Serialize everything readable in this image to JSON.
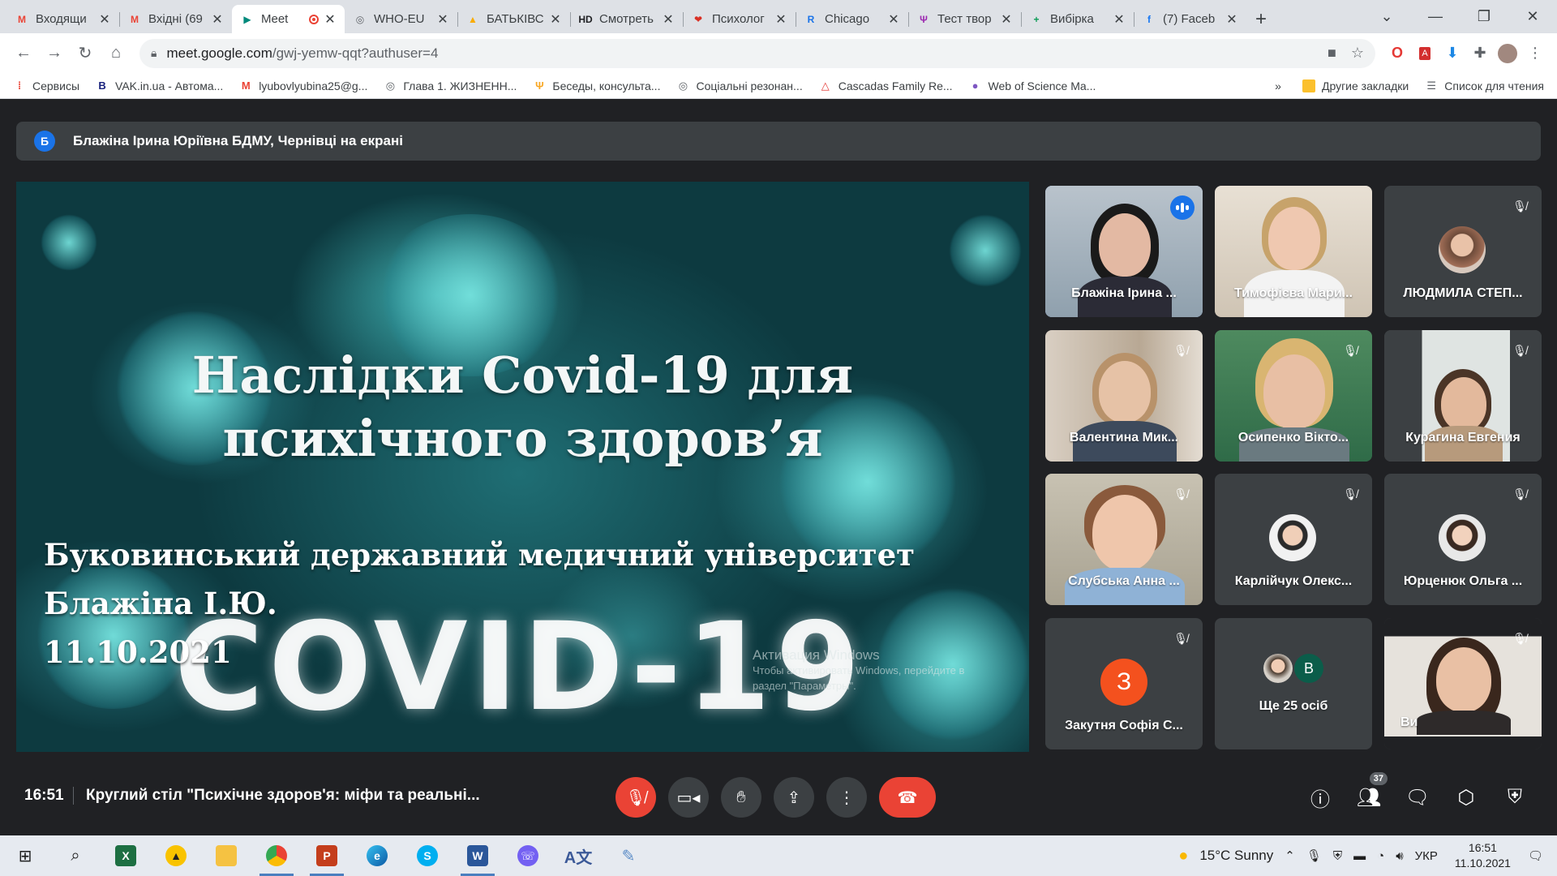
{
  "browser": {
    "tabs": [
      {
        "title": "Входящи",
        "icon": "gmail-icon",
        "color": "#ea4335",
        "glyph": "M"
      },
      {
        "title": "Вхідні (69",
        "icon": "gmail-icon",
        "color": "#ea4335",
        "glyph": "M"
      },
      {
        "title": "Meet",
        "icon": "meet-icon",
        "color": "#00897b",
        "glyph": "▶",
        "active": true
      },
      {
        "title": "WHO-EU",
        "icon": "globe-icon",
        "color": "#5f6368",
        "glyph": "◎"
      },
      {
        "title": "БАТЬКІВС",
        "icon": "drive-icon",
        "color": "#f9ab00",
        "glyph": "▲"
      },
      {
        "title": "Смотреть",
        "icon": "hd-icon",
        "color": "#202124",
        "glyph": "HD"
      },
      {
        "title": "Психолог",
        "icon": "lips-icon",
        "color": "#d93025",
        "glyph": "❤"
      },
      {
        "title": "Chicago",
        "icon": "r-icon",
        "color": "#1a73e8",
        "glyph": "R"
      },
      {
        "title": "Тест твор",
        "icon": "fork-icon",
        "color": "#9c27b0",
        "glyph": "Ψ"
      },
      {
        "title": "Вибірка",
        "icon": "sheets-icon",
        "color": "#0f9d58",
        "glyph": "+"
      },
      {
        "title": "(7) Faceb",
        "icon": "facebook-icon",
        "color": "#1877f2",
        "glyph": "f"
      }
    ],
    "url_host": "meet.google.com",
    "url_path": "/gwj-yemw-qqt?authuser=4",
    "bookmarks": [
      {
        "label": "Сервисы",
        "icon": "apps-icon",
        "color": "#ea4335",
        "glyph": "⁞"
      },
      {
        "label": "VAK.in.ua - Автома...",
        "icon": "b-icon",
        "color": "#1a237e",
        "glyph": "B"
      },
      {
        "label": "lyubovlyubina25@g...",
        "icon": "gmail-icon",
        "color": "#ea4335",
        "glyph": "M"
      },
      {
        "label": "Глава 1. ЖИЗНЕНН...",
        "icon": "globe-icon",
        "color": "#5f6368",
        "glyph": "◎"
      },
      {
        "label": "Беседы, консульта...",
        "icon": "psi-icon",
        "color": "#f9a825",
        "glyph": "Ψ"
      },
      {
        "label": "Соціальні резонан...",
        "icon": "globe-icon",
        "color": "#5f6368",
        "glyph": "◎"
      },
      {
        "label": "Cascadas Family Re...",
        "icon": "triangle-icon",
        "color": "#e53935",
        "glyph": "△"
      },
      {
        "label": "Web of Science Ma...",
        "icon": "wos-icon",
        "color": "#7e57c2",
        "glyph": "●"
      }
    ],
    "other_bookmarks": "Другие закладки",
    "reading_list": "Список для чтения"
  },
  "meet": {
    "presenter_initial": "Б",
    "presenter_text": "Блажіна Ірина Юріївна БДМУ, Чернівці на екрані",
    "slide": {
      "title_line1": "Наслідки Covid-19 для",
      "title_line2": "психічного здоров’я",
      "sub_line1": "Буковинський державний медичний університет",
      "sub_line2": "Блажіна І.Ю.",
      "sub_line3": "11.10.2021",
      "big_text": "COVID-19",
      "watermark_title": "Активация Windows",
      "watermark_line1": "Чтобы активировать Windows, перейдите в",
      "watermark_line2": "раздел \"Параметры\"."
    },
    "participants": [
      {
        "name": "Блажіна Ірина ...",
        "type": "video",
        "speaking": true
      },
      {
        "name": "Тимофієва Мари...",
        "type": "video",
        "muted": false
      },
      {
        "name": "ЛЮДМИЛА СТЕП...",
        "type": "photo",
        "muted": true
      },
      {
        "name": "Валентина Мик...",
        "type": "video",
        "muted": true
      },
      {
        "name": "Осипенко Вікто...",
        "type": "video",
        "muted": true
      },
      {
        "name": "Курагина Евгения",
        "type": "video",
        "muted": true
      },
      {
        "name": "Слубська Анна ...",
        "type": "video",
        "muted": true
      },
      {
        "name": "Карлійчук Олекс...",
        "type": "photo",
        "muted": true
      },
      {
        "name": "Юрценюк Ольга ...",
        "type": "photo",
        "muted": true
      },
      {
        "name": "Закутня Софія С...",
        "type": "letter",
        "letter": "З",
        "muted": true
      },
      {
        "name": "Ще 25 осіб",
        "type": "more",
        "letter": "B"
      },
      {
        "name": "Ви",
        "type": "video",
        "muted": true
      }
    ],
    "time": "16:51",
    "meeting_title": "Круглий стіл \"Психічне здоров'я: міфи та реальні...",
    "people_count": "37"
  },
  "taskbar": {
    "weather": "15°C  Sunny",
    "lang": "УКР",
    "time": "16:51",
    "date": "11.10.2021"
  }
}
